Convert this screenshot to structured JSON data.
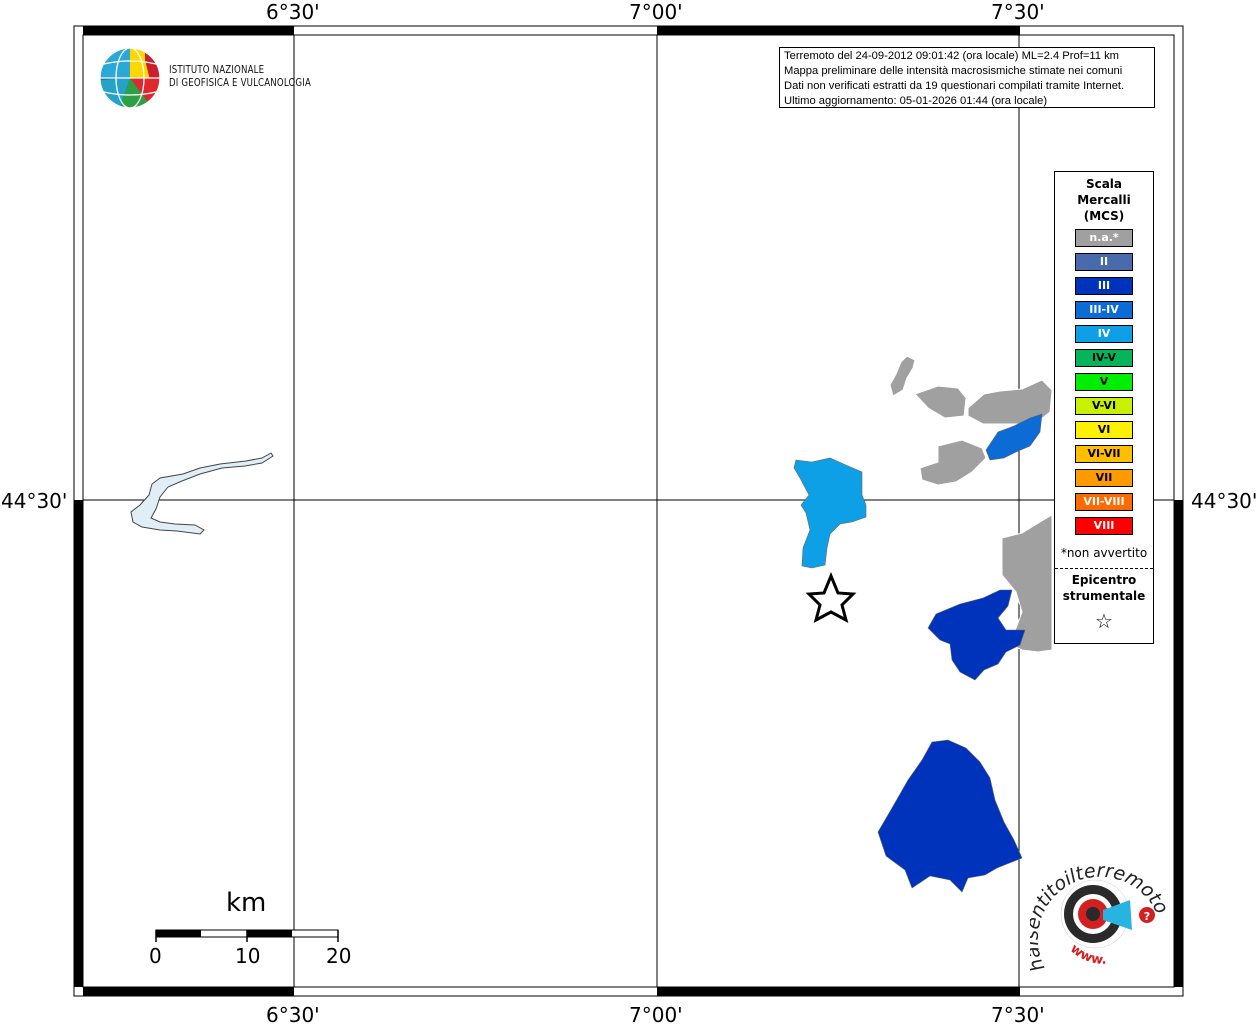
{
  "map": {
    "axes": {
      "top": [
        "6°30'",
        "7°00'",
        "7°30'"
      ],
      "bottom": [
        "6°30'",
        "7°00'",
        "7°30'"
      ],
      "left": "44°30'",
      "right": "44°30'"
    },
    "info_lines": [
      "Terremoto del 24-09-2012 09:01:42 (ora locale) ML=2.4 Prof=11 km",
      "Mappa preliminare delle intensità macrosismiche stimate nei comuni",
      "Dati non verificati estratti da 19 questionari compilati tramite Internet.",
      "Ultimo aggiornamento: 05-01-2026 01:44 (ora locale)"
    ],
    "logo": {
      "line1": "ISTITUTO NAZIONALE",
      "line2": "DI GEOFISICA E VULCANOLOGIA"
    },
    "scale_bar": {
      "unit": "km",
      "ticks": [
        "0",
        "10",
        "20"
      ]
    },
    "site_logo": {
      "text": "haisentitoilterremoto.it",
      "prefix": "www."
    }
  },
  "legend": {
    "title_lines": [
      "Scala",
      "Mercalli",
      "(MCS)"
    ],
    "items": [
      {
        "label": "n.a.*",
        "color": "#a0a0a0"
      },
      {
        "label": "II",
        "color": "#4a6aae"
      },
      {
        "label": "III",
        "color": "#0033bb"
      },
      {
        "label": "III-IV",
        "color": "#0d6bd6"
      },
      {
        "label": "IV",
        "color": "#0da0e6"
      },
      {
        "label": "IV-V",
        "color": "#05b45a"
      },
      {
        "label": "V",
        "color": "#00ee00"
      },
      {
        "label": "V-VI",
        "color": "#c8f000"
      },
      {
        "label": "VI",
        "color": "#fff000"
      },
      {
        "label": "VI-VII",
        "color": "#ffbe00"
      },
      {
        "label": "VII",
        "color": "#ff9a00"
      },
      {
        "label": "VII-VIII",
        "color": "#ff6a00"
      },
      {
        "label": "VIII",
        "color": "#ff0000"
      }
    ],
    "note": "*non avvertito",
    "epicenter_lines": [
      "Epicentro",
      "strumentale"
    ],
    "epicenter_symbol": "☆"
  },
  "areas": [
    {
      "name": "area-iv",
      "intensity": "IV"
    },
    {
      "name": "area-iii-iv",
      "intensity": "III-IV"
    },
    {
      "name": "area-iii-north",
      "intensity": "III"
    },
    {
      "name": "area-iii-south",
      "intensity": "III"
    },
    {
      "name": "area-na",
      "intensity": "n.a.*"
    }
  ],
  "colors": {
    "na": "#a0a0a0",
    "iii": "#0033bb",
    "iii_iv": "#0d6bd6",
    "iv": "#0da0e6",
    "lake": "#e0eef8"
  }
}
